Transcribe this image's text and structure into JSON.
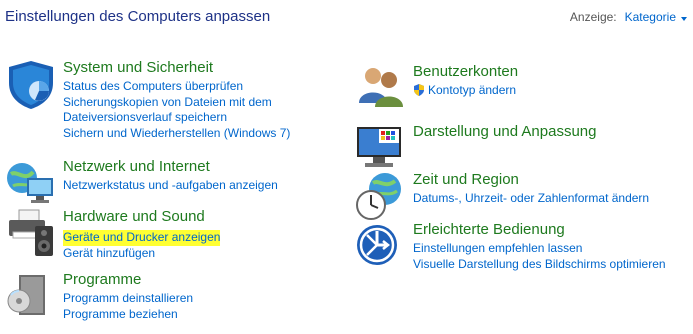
{
  "header": {
    "title": "Einstellungen des Computers anpassen",
    "view_label": "Anzeige:",
    "view_value": "Kategorie"
  },
  "left": [
    {
      "title": "System und Sicherheit",
      "icon": "security-shield-icon",
      "links": [
        "Status des Computers überprüfen",
        "Sicherungskopien von Dateien mit dem",
        "Dateiversionsverlauf speichern",
        "Sichern und Wiederherstellen (Windows 7)"
      ]
    },
    {
      "title": "Netzwerk und Internet",
      "icon": "network-globe-icon",
      "links": [
        "Netzwerkstatus und -aufgaben anzeigen"
      ]
    },
    {
      "title": "Hardware und Sound",
      "icon": "printer-speaker-icon",
      "links": [
        "Geräte und Drucker anzeigen",
        "Gerät hinzufügen"
      ]
    },
    {
      "title": "Programme",
      "icon": "programs-disk-icon",
      "links": [
        "Programm deinstallieren",
        "Programme beziehen"
      ]
    }
  ],
  "right": [
    {
      "title": "Benutzerkonten",
      "icon": "users-icon",
      "links": [
        "Kontotyp ändern"
      ]
    },
    {
      "title": "Darstellung und Anpassung",
      "icon": "display-icon",
      "links": []
    },
    {
      "title": "Zeit und Region",
      "icon": "clock-globe-icon",
      "links": [
        "Datums-, Uhrzeit- oder Zahlenformat ändern"
      ]
    },
    {
      "title": "Erleichterte Bedienung",
      "icon": "ease-of-access-icon",
      "links": [
        "Einstellungen empfehlen lassen",
        "Visuelle Darstellung des Bildschirms optimieren"
      ]
    }
  ],
  "highlight_color": "#ffff33",
  "title_color": "#1e7a1e",
  "link_color": "#0066cc"
}
